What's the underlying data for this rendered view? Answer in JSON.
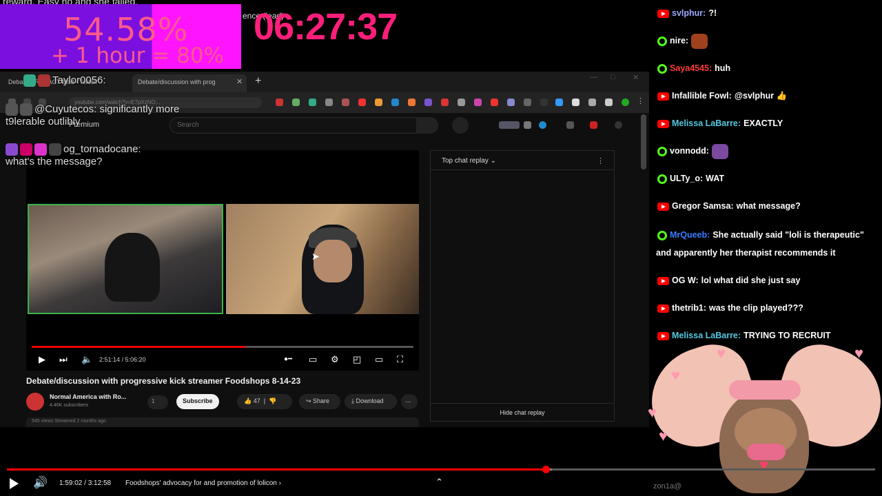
{
  "overlay": {
    "top_caption": "reward. Easy no and she failed.",
    "goal_percent": "54.58%",
    "goal_bonus": "+ 1 hour = 80%",
    "timer": "06:27:37",
    "timer_label": "ence (lead)",
    "colors": {
      "goal_purple": "#7a0fe0",
      "goal_magenta": "#ff14ff",
      "timer": "#ff1f7a"
    }
  },
  "browser": {
    "tab1": "Debating REDACT Mod - Twitch",
    "tab2": "Debate/discussion with prog",
    "url": "youtube.com/watch?v=E7pXzNO...",
    "premium_label": "Premium",
    "search_placeholder": "Search",
    "icons": [
      "search-icon",
      "mic-icon",
      "cast-icon",
      "notifications-icon",
      "avatar"
    ]
  },
  "overlay_chat": [
    {
      "user": "Taylor0056:",
      "text": ""
    },
    {
      "user": "@Cuyutecos:",
      "text": "significantly more t9lerable outlibly"
    },
    {
      "user": "og_tornadocane:",
      "text": "what's the message?"
    }
  ],
  "player": {
    "time": "2:51:14 / 5:06:20",
    "progress": 0.56,
    "icons": [
      "play-icon",
      "next-icon",
      "volume-icon",
      "autoplay-toggle",
      "captions-icon",
      "settings-icon",
      "miniplayer-icon",
      "theater-icon",
      "fullscreen-icon"
    ]
  },
  "video": {
    "title": "Debate/discussion with progressive kick streamer Foodshops 8-14-23",
    "channel": "Normal America with Ro...",
    "subs": "4.46K subscribers",
    "member_label": "1",
    "subscribe_label": "Subscribe",
    "likes": "47",
    "share_label": "Share",
    "download_label": "Download",
    "more_label": "...",
    "desc": "545 views  Streamed 2 months ago"
  },
  "yt_chat": {
    "header": "Top chat replay",
    "hide": "Hide chat replay"
  },
  "chat": {
    "messages": [
      {
        "platform": "youtube",
        "user": "svlphur:",
        "text": "?!",
        "color": "#9aa8ff"
      },
      {
        "platform": "kick",
        "user": "nire:",
        "text": "",
        "color": "#ffffff",
        "emote": "#a0411e"
      },
      {
        "platform": "kick",
        "user": "Saya4545:",
        "text": "huh",
        "color": "#ff3b3b"
      },
      {
        "platform": "youtube",
        "user": "Infallible Fowl:",
        "text": "@svlphur 👍",
        "color": "#ffffff"
      },
      {
        "platform": "youtube",
        "user": "Melissa LaBarre:",
        "text": "EXACTLY",
        "color": "#55c8e0"
      },
      {
        "platform": "kick",
        "user": "vonnodd:",
        "text": "",
        "color": "#ffffff",
        "emote": "#7a4aa0"
      },
      {
        "platform": "kick",
        "user": "ULTy_o:",
        "text": "WAT",
        "color": "#ffffff"
      },
      {
        "platform": "youtube",
        "user": "Gregor Samsa:",
        "text": "what message?",
        "color": "#ffffff"
      },
      {
        "platform": "kick",
        "user": "MrQueeb:",
        "text": "She actually said \"loli is therapeutic\" and apparently her therapist recommends it",
        "color": "#3a7bff"
      },
      {
        "platform": "youtube",
        "user": "OG W:",
        "text": "lol what did she just say",
        "color": "#ffffff"
      },
      {
        "platform": "youtube",
        "user": "thetrib1:",
        "text": "was the clip played???",
        "color": "#ffffff"
      },
      {
        "platform": "youtube",
        "user": "Melissa LaBarre:",
        "text": "TRYING TO RECRUIT",
        "color": "#55c8e0"
      }
    ]
  },
  "mascot_caption": "zon1a@",
  "bottom_player": {
    "time": "1:59:02 / 3:12:58",
    "chapter": "Foodshops' advocacy for and promotion of lolicon",
    "progress": 0.6206,
    "buffered": 0.628
  }
}
